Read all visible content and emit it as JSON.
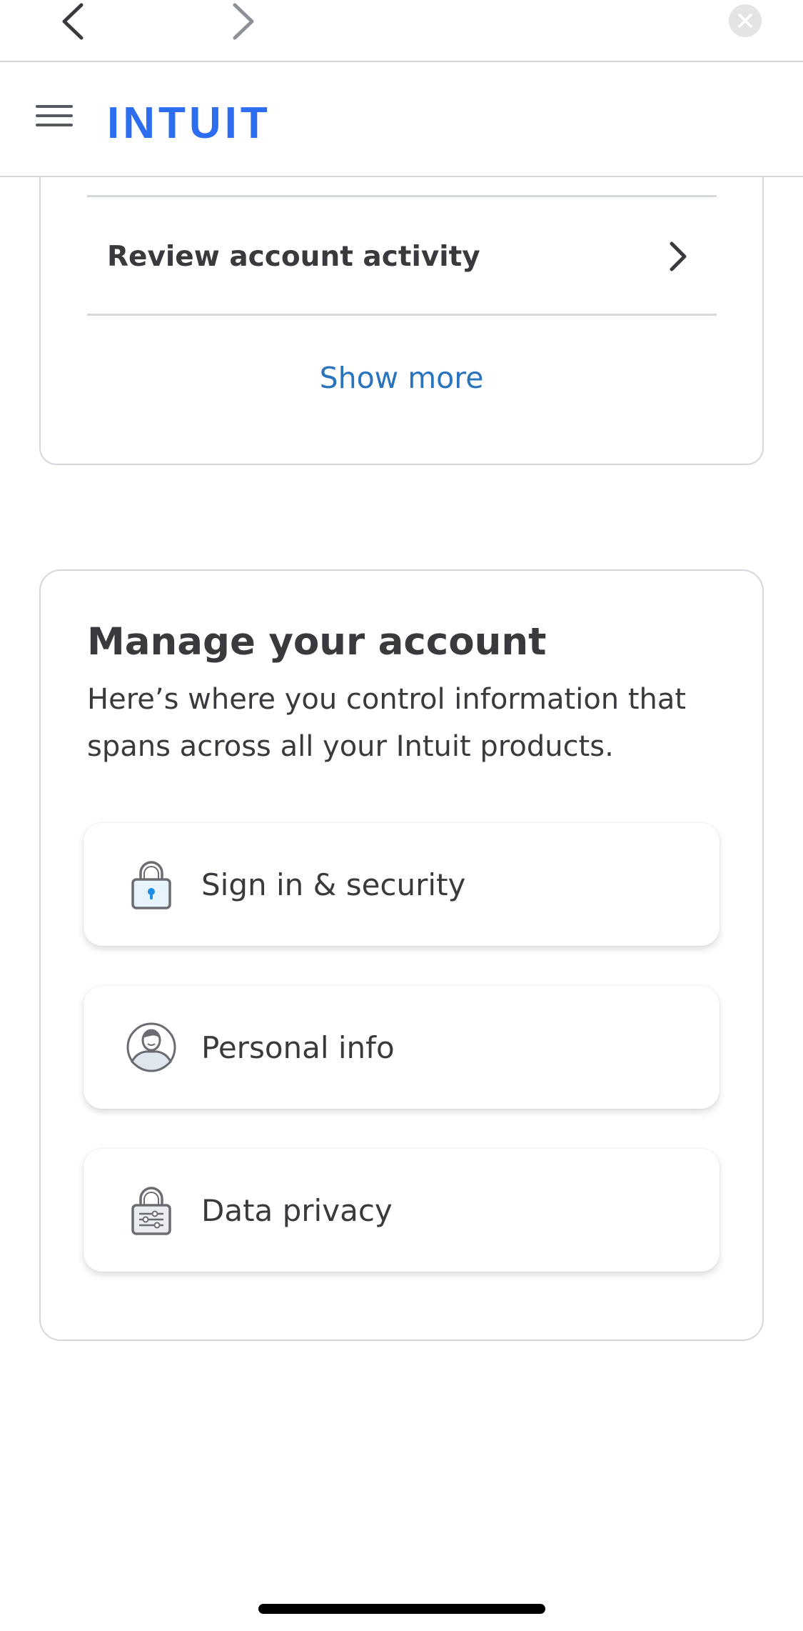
{
  "browser": {
    "back_icon": "chevron-left-icon",
    "forward_icon": "chevron-right-icon",
    "close_icon": "close-icon"
  },
  "header": {
    "menu_icon": "hamburger-menu-icon",
    "logo_text": "INTUIT",
    "brand_color": "#2d6ef0"
  },
  "activity_card": {
    "review_label": "Review account activity",
    "show_more_label": "Show more",
    "link_color": "#2a73bd"
  },
  "manage_card": {
    "title": "Manage your account",
    "subtitle": "Here’s where you control information that spans across all your Intuit products.",
    "options": [
      {
        "label": "Sign in & security",
        "icon": "lock-icon"
      },
      {
        "label": "Personal info",
        "icon": "person-icon"
      },
      {
        "label": "Data privacy",
        "icon": "privacy-lock-icon"
      }
    ]
  }
}
